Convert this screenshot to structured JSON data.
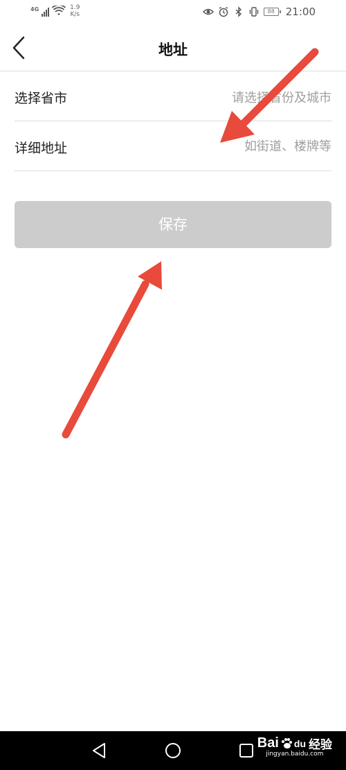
{
  "status_bar": {
    "network_type": "4G",
    "speed_value": "1.9",
    "speed_unit": "K/s",
    "battery_level": "88",
    "time": "21:00",
    "icons": [
      "signal-icon",
      "wifi-icon",
      "eye-icon",
      "alarm-icon",
      "bluetooth-icon",
      "vibrate-icon",
      "battery-icon"
    ]
  },
  "navbar": {
    "title": "地址",
    "back_icon": "chevron-left-icon"
  },
  "form": {
    "province_city": {
      "label": "选择省市",
      "placeholder": "请选择省份及城市"
    },
    "detail_address": {
      "label": "详细地址",
      "placeholder": "如街道、楼牌等"
    }
  },
  "save_button": {
    "label": "保存"
  },
  "annotation_colors": {
    "arrow": "#e84a3b"
  },
  "system_nav": {
    "icons": [
      "back-triangle-icon",
      "home-circle-icon",
      "recent-square-icon"
    ]
  },
  "watermark": {
    "brand": "Bai",
    "brand_suffix": "du",
    "label": "经验",
    "url": "jingyan.baidu.com"
  }
}
